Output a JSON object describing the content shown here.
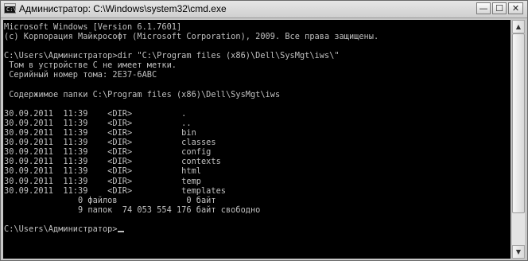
{
  "window": {
    "title": "Администратор: C:\\Windows\\system32\\cmd.exe",
    "app_icon_glyph": "C:\\",
    "buttons": {
      "minimize": "—",
      "maximize": "☐",
      "close": "✕"
    }
  },
  "console": {
    "text_color": "#c0c0c0",
    "background_color": "#000000",
    "lines": [
      "Microsoft Windows [Version 6.1.7601]",
      "(c) Корпорация Майкрософт (Microsoft Corporation), 2009. Все права защищены.",
      "",
      "C:\\Users\\Администратор>dir \"C:\\Program files (x86)\\Dell\\SysMgt\\iws\\\"",
      " Том в устройстве C не имеет метки.",
      " Серийный номер тома: 2E37-6ABC",
      "",
      " Содержимое папки C:\\Program files (x86)\\Dell\\SysMgt\\iws",
      "",
      "30.09.2011  11:39    <DIR>          .",
      "30.09.2011  11:39    <DIR>          ..",
      "30.09.2011  11:39    <DIR>          bin",
      "30.09.2011  11:39    <DIR>          classes",
      "30.09.2011  11:39    <DIR>          config",
      "30.09.2011  11:39    <DIR>          contexts",
      "30.09.2011  11:39    <DIR>          html",
      "30.09.2011  11:39    <DIR>          temp",
      "30.09.2011  11:39    <DIR>          templates",
      "               0 файлов              0 байт",
      "               9 папок  74 053 554 176 байт свободно",
      "",
      "C:\\Users\\Администратор>"
    ]
  },
  "scrollbar": {
    "up_arrow": "▲",
    "down_arrow": "▼",
    "position_fraction": 0.0
  }
}
